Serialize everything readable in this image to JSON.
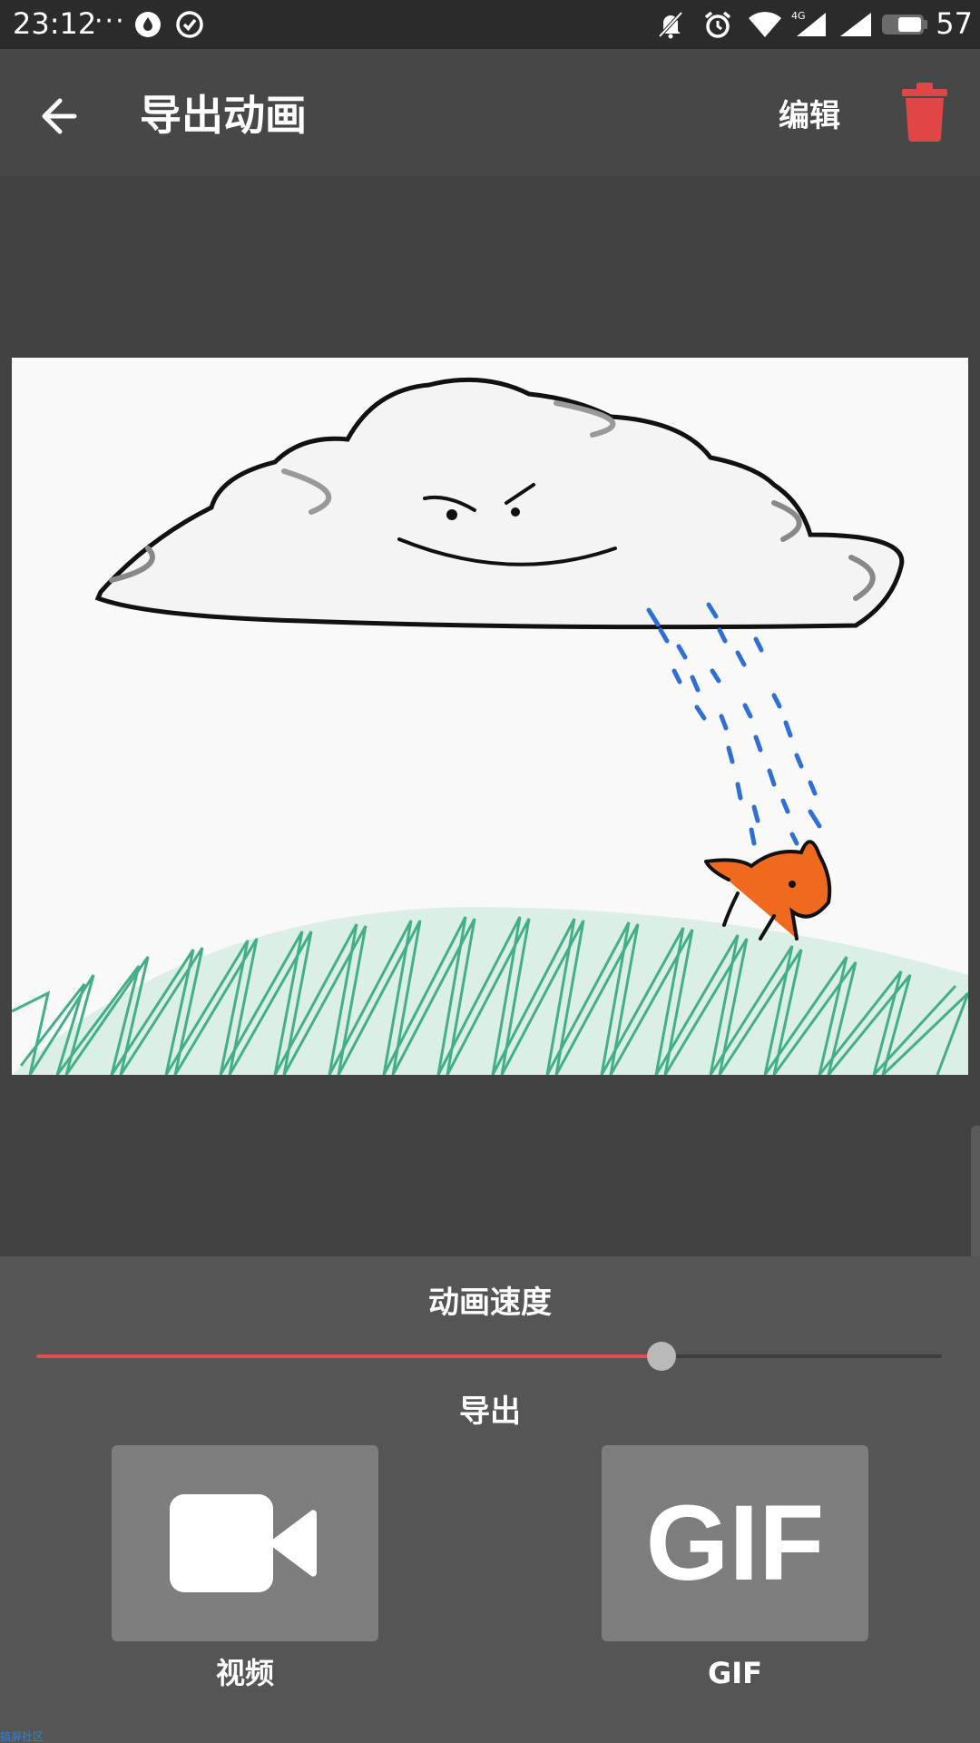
{
  "status_bar": {
    "time": "23:12",
    "dots": "···",
    "battery": "57",
    "icons": [
      "water-drop-icon",
      "check-circle-icon",
      "bell-off-icon",
      "alarm-icon",
      "wifi-icon",
      "signal-4g-icon",
      "signal-icon",
      "battery-icon"
    ]
  },
  "app_bar": {
    "back_icon": "arrow-left-icon",
    "title": "导出动画",
    "edit_label": "编辑",
    "delete_icon": "trash-icon",
    "delete_color": "#e04646"
  },
  "canvas": {
    "image": "drawing-cloud-rain-animal-grass"
  },
  "panel": {
    "speed_label": "动画速度",
    "speed_value": 0.69,
    "accent_color": "#e24d4d",
    "export_label": "导出",
    "video_icon": "video-camera-icon",
    "video_label": "视频",
    "gif_text": "GIF",
    "gif_label": "GIF"
  },
  "watermark": "搞屏社区"
}
